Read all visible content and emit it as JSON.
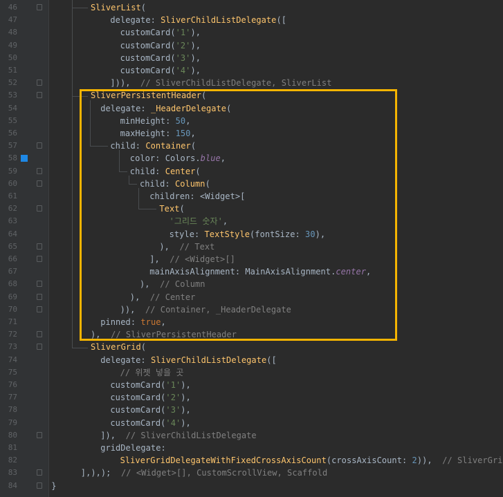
{
  "editor": {
    "colors": {
      "background": "#2b2b2b",
      "gutter": "#313335",
      "highlight_box": "#f5b400",
      "color_marker": "#1e88e5"
    },
    "lines": [
      {
        "n": "46",
        "fold": true,
        "indent": 0,
        "tokens": [
          [
            "cls",
            "SliverList"
          ],
          [
            "plain",
            "("
          ]
        ]
      },
      {
        "n": "47",
        "indent": 2,
        "tokens": [
          [
            "param",
            "delegate: "
          ],
          [
            "cls",
            "SliverChildListDelegate"
          ],
          [
            "plain",
            "(["
          ]
        ]
      },
      {
        "n": "48",
        "indent": 3,
        "tokens": [
          [
            "plain",
            "customCard("
          ],
          [
            "str",
            "'1'"
          ],
          [
            "plain",
            "),"
          ]
        ]
      },
      {
        "n": "49",
        "indent": 3,
        "tokens": [
          [
            "plain",
            "customCard("
          ],
          [
            "str",
            "'2'"
          ],
          [
            "plain",
            "),"
          ]
        ]
      },
      {
        "n": "50",
        "indent": 3,
        "tokens": [
          [
            "plain",
            "customCard("
          ],
          [
            "str",
            "'3'"
          ],
          [
            "plain",
            "),"
          ]
        ]
      },
      {
        "n": "51",
        "indent": 3,
        "tokens": [
          [
            "plain",
            "customCard("
          ],
          [
            "str",
            "'4'"
          ],
          [
            "plain",
            "),"
          ]
        ]
      },
      {
        "n": "52",
        "fold": true,
        "indent": 2,
        "tokens": [
          [
            "plain",
            "])),  "
          ],
          [
            "cmt",
            "// SliverChildListDelegate, SliverList"
          ]
        ]
      },
      {
        "n": "53",
        "fold": true,
        "indent": 0,
        "tokens": [
          [
            "cls",
            "SliverPersistentHeader"
          ],
          [
            "plain",
            "("
          ]
        ]
      },
      {
        "n": "54",
        "indent": 1,
        "tokens": [
          [
            "param",
            "delegate: "
          ],
          [
            "cls",
            "_HeaderDelegate"
          ],
          [
            "plain",
            "("
          ]
        ]
      },
      {
        "n": "55",
        "indent": 3,
        "tokens": [
          [
            "param",
            "minHeight: "
          ],
          [
            "num",
            "50"
          ],
          [
            "plain",
            ","
          ]
        ]
      },
      {
        "n": "56",
        "indent": 3,
        "tokens": [
          [
            "param",
            "maxHeight: "
          ],
          [
            "num",
            "150"
          ],
          [
            "plain",
            ","
          ]
        ]
      },
      {
        "n": "57",
        "fold": true,
        "indent": 2,
        "tokens": [
          [
            "param",
            "child: "
          ],
          [
            "cls",
            "Container"
          ],
          [
            "plain",
            "("
          ]
        ]
      },
      {
        "n": "58",
        "marker": true,
        "indent": 4,
        "tokens": [
          [
            "param",
            "color: "
          ],
          [
            "plain",
            "Colors."
          ],
          [
            "field",
            "blue"
          ],
          [
            "plain",
            ","
          ]
        ]
      },
      {
        "n": "59",
        "fold": true,
        "indent": 4,
        "tokens": [
          [
            "param",
            "child: "
          ],
          [
            "cls",
            "Center"
          ],
          [
            "plain",
            "("
          ]
        ]
      },
      {
        "n": "60",
        "fold": true,
        "indent": 5,
        "tokens": [
          [
            "param",
            "child: "
          ],
          [
            "cls",
            "Column"
          ],
          [
            "plain",
            "("
          ]
        ]
      },
      {
        "n": "61",
        "indent": 6,
        "tokens": [
          [
            "param",
            "children: "
          ],
          [
            "plain",
            "<Widget>["
          ]
        ]
      },
      {
        "n": "62",
        "fold": true,
        "indent": 7,
        "tokens": [
          [
            "cls",
            "Text"
          ],
          [
            "plain",
            "("
          ]
        ]
      },
      {
        "n": "63",
        "indent": 8,
        "tokens": [
          [
            "str",
            "'그리드 숫자'"
          ],
          [
            "plain",
            ","
          ]
        ]
      },
      {
        "n": "64",
        "indent": 8,
        "tokens": [
          [
            "param",
            "style: "
          ],
          [
            "cls",
            "TextStyle"
          ],
          [
            "plain",
            "(fontSize: "
          ],
          [
            "num",
            "30"
          ],
          [
            "plain",
            "),"
          ]
        ]
      },
      {
        "n": "65",
        "fold": true,
        "indent": 7,
        "tokens": [
          [
            "plain",
            "),  "
          ],
          [
            "cmt",
            "// Text"
          ]
        ]
      },
      {
        "n": "66",
        "fold": true,
        "indent": 6,
        "tokens": [
          [
            "plain",
            "],  "
          ],
          [
            "cmt",
            "// <Widget>[]"
          ]
        ]
      },
      {
        "n": "67",
        "indent": 6,
        "tokens": [
          [
            "param",
            "mainAxisAlignment: "
          ],
          [
            "plain",
            "MainAxisAlignment."
          ],
          [
            "field",
            "center"
          ],
          [
            "plain",
            ","
          ]
        ]
      },
      {
        "n": "68",
        "fold": true,
        "indent": 5,
        "tokens": [
          [
            "plain",
            "),  "
          ],
          [
            "cmt",
            "// Column"
          ]
        ]
      },
      {
        "n": "69",
        "fold": true,
        "indent": 4,
        "tokens": [
          [
            "plain",
            "),  "
          ],
          [
            "cmt",
            "// Center"
          ]
        ]
      },
      {
        "n": "70",
        "fold": true,
        "indent": 3,
        "tokens": [
          [
            "plain",
            ")),  "
          ],
          [
            "cmt",
            "// Container, _HeaderDelegate"
          ]
        ]
      },
      {
        "n": "71",
        "indent": 1,
        "tokens": [
          [
            "param",
            "pinned: "
          ],
          [
            "kw",
            "true"
          ],
          [
            "plain",
            ","
          ]
        ]
      },
      {
        "n": "72",
        "fold": true,
        "indent": 0,
        "tokens": [
          [
            "plain",
            "),  "
          ],
          [
            "cmt",
            "// SliverPersistentHeader"
          ]
        ]
      },
      {
        "n": "73",
        "fold": true,
        "indent": 0,
        "tokens": [
          [
            "cls",
            "SliverGrid"
          ],
          [
            "plain",
            "("
          ]
        ]
      },
      {
        "n": "74",
        "indent": 1,
        "tokens": [
          [
            "param",
            "delegate: "
          ],
          [
            "cls",
            "SliverChildListDelegate"
          ],
          [
            "plain",
            "(["
          ]
        ]
      },
      {
        "n": "75",
        "indent": 3,
        "tokens": [
          [
            "cmt",
            "// 위젯 넣을 곳"
          ]
        ]
      },
      {
        "n": "76",
        "indent": 2,
        "tokens": [
          [
            "plain",
            "customCard("
          ],
          [
            "str",
            "'1'"
          ],
          [
            "plain",
            "),"
          ]
        ]
      },
      {
        "n": "77",
        "indent": 2,
        "tokens": [
          [
            "plain",
            "customCard("
          ],
          [
            "str",
            "'2'"
          ],
          [
            "plain",
            "),"
          ]
        ]
      },
      {
        "n": "78",
        "indent": 2,
        "tokens": [
          [
            "plain",
            "customCard("
          ],
          [
            "str",
            "'3'"
          ],
          [
            "plain",
            "),"
          ]
        ]
      },
      {
        "n": "79",
        "indent": 2,
        "tokens": [
          [
            "plain",
            "customCard("
          ],
          [
            "str",
            "'4'"
          ],
          [
            "plain",
            "),"
          ]
        ]
      },
      {
        "n": "80",
        "fold": true,
        "indent": 1,
        "tokens": [
          [
            "plain",
            "]),  "
          ],
          [
            "cmt",
            "// SliverChildListDelegate"
          ]
        ]
      },
      {
        "n": "81",
        "indent": 1,
        "tokens": [
          [
            "param",
            "gridDelegate:"
          ]
        ]
      },
      {
        "n": "82",
        "indent": 3,
        "tokens": [
          [
            "cls",
            "SliverGridDelegateWithFixedCrossAxisCount"
          ],
          [
            "plain",
            "(crossAxisCount: "
          ],
          [
            "num",
            "2"
          ],
          [
            "plain",
            "))"
          ],
          [
            "plain",
            ",  "
          ],
          [
            "cmt",
            "// SliverGrid"
          ]
        ]
      },
      {
        "n": "83",
        "fold": true,
        "indent": -1,
        "tokens": [
          [
            "plain",
            "],),);  "
          ],
          [
            "cmt",
            "// <Widget>[], CustomScrollView, Scaffold"
          ]
        ]
      },
      {
        "n": "84",
        "fold": true,
        "indent": -4,
        "tokens": [
          [
            "plain",
            "}"
          ]
        ]
      }
    ]
  }
}
